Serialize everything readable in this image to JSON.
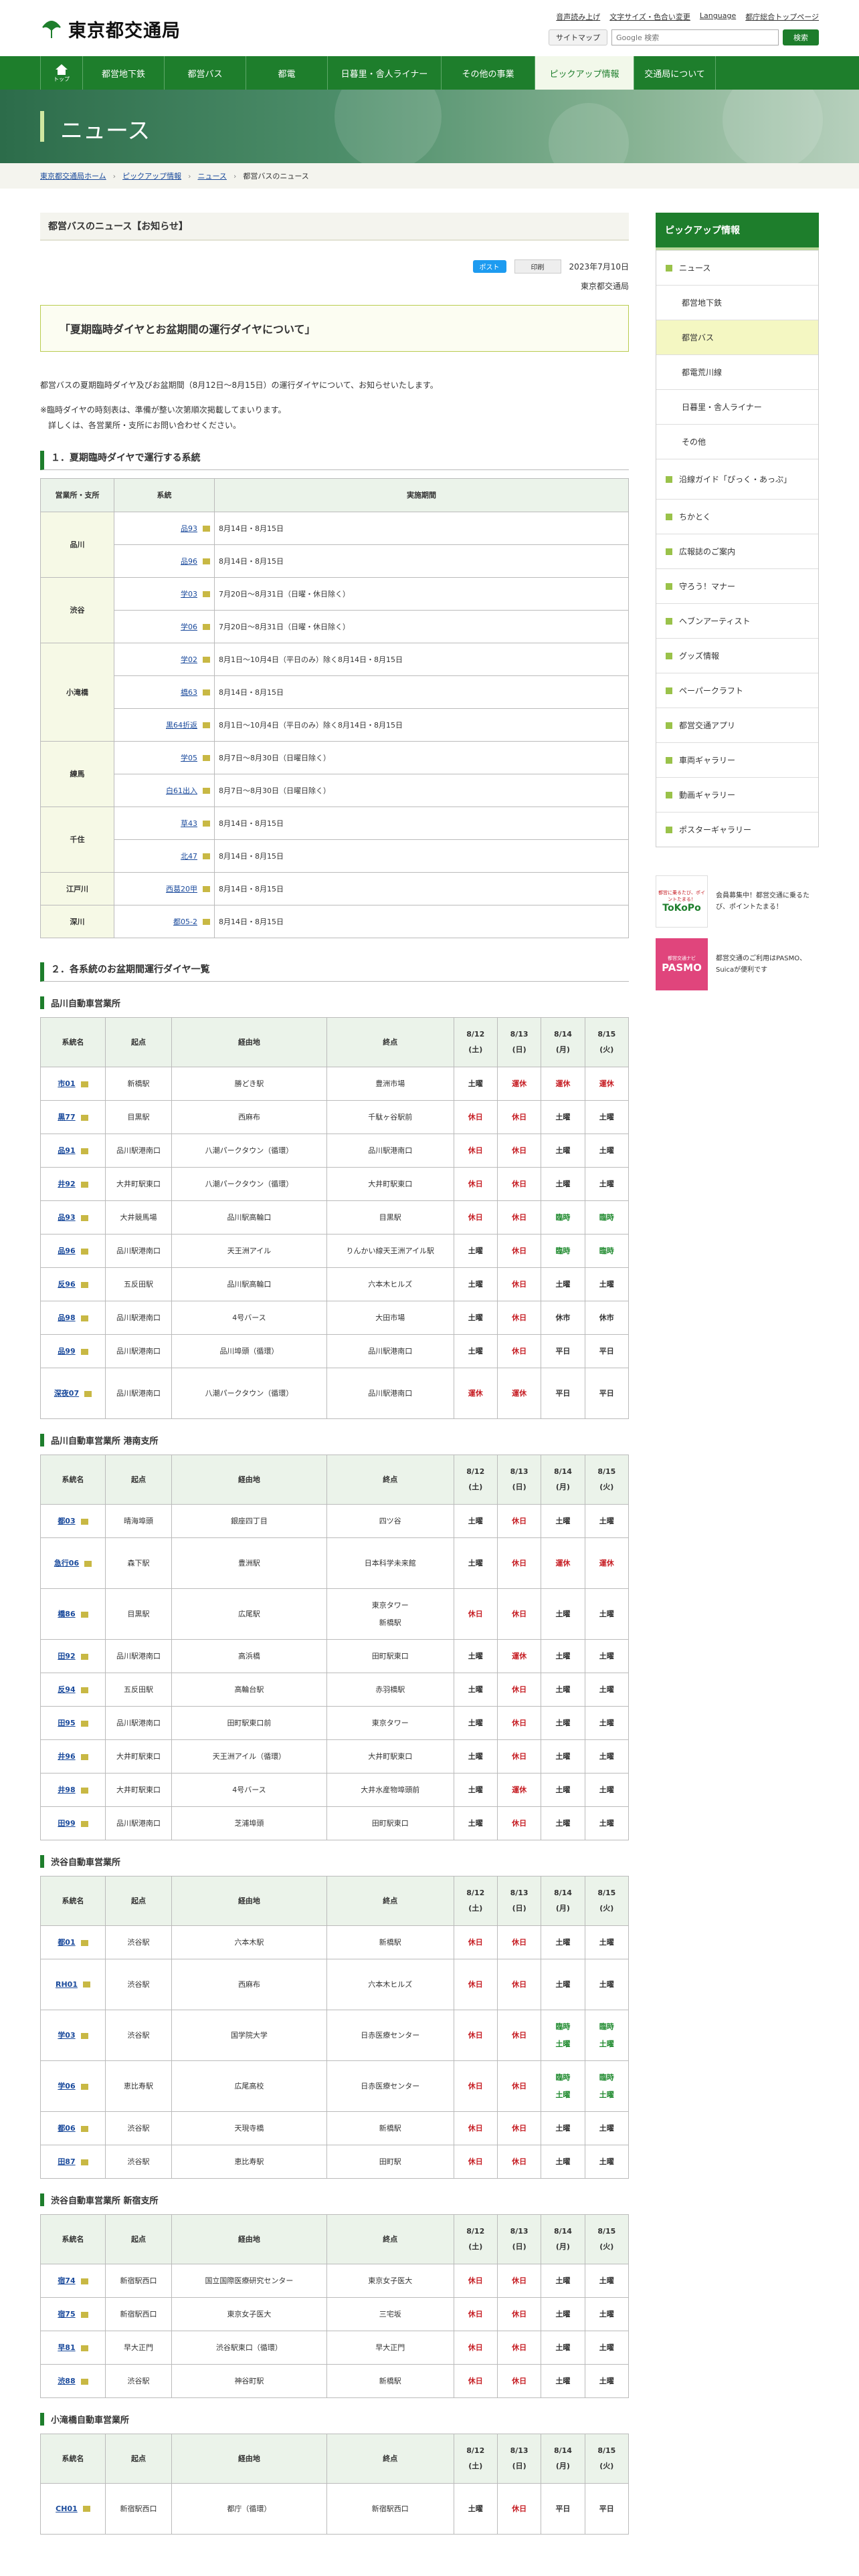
{
  "header": {
    "logo": "東京都交通局",
    "util": [
      "音声読み上げ",
      "文字サイズ・色合い変更",
      "Language",
      "都庁総合トップページ"
    ],
    "sitemap": "サイトマップ",
    "search_placeholder": "Google 検索",
    "search_button": "検索"
  },
  "gnav": {
    "home": "トップ",
    "items": [
      "都営地下鉄",
      "都営バス",
      "都電",
      "日暮里・舎人ライナー",
      "その他の事業",
      "ピックアップ情報",
      "交通局について"
    ]
  },
  "banner_title": "ニュース",
  "breadcrumb": [
    "東京都交通局ホーム",
    "ピックアップ情報",
    "ニュース",
    "都営バスのニュース"
  ],
  "page_title": "都営バスのニュース【お知らせ】",
  "share": {
    "tweet": "ポスト",
    "print": "印刷",
    "date": "2023年7月10日"
  },
  "org": "東京都交通局",
  "headline": "「夏期臨時ダイヤとお盆期間の運行ダイヤについて」",
  "lead": "都営バスの夏期臨時ダイヤ及びお盆期間（8月12日〜8月15日）の運行ダイヤについて、お知らせいたします。",
  "notes": [
    "※臨時ダイヤの時刻表は、準備が整い次第順次掲載してまいります。",
    "詳しくは、各営業所・支所にお問い合わせください。"
  ],
  "section1": "１．夏期臨時ダイヤで運行する系統",
  "t1": {
    "headers": [
      "営業所・支所",
      "系統",
      "実施期間"
    ],
    "groups": [
      {
        "branch": "品川",
        "rows": [
          [
            "品93",
            "8月14日・8月15日"
          ],
          [
            "品96",
            "8月14日・8月15日"
          ]
        ]
      },
      {
        "branch": "渋谷",
        "rows": [
          [
            "学03",
            "7月20日〜8月31日（日曜・休日除く）"
          ],
          [
            "学06",
            "7月20日〜8月31日（日曜・休日除く）"
          ]
        ]
      },
      {
        "branch": "小滝橋",
        "rows": [
          [
            "学02",
            "8月1日〜10月4日（平日のみ）除く8月14日・8月15日"
          ],
          [
            "橋63",
            "8月14日・8月15日"
          ],
          [
            "黒64折返",
            "8月1日〜10月4日（平日のみ）除く8月14日・8月15日"
          ]
        ]
      },
      {
        "branch": "練馬",
        "rows": [
          [
            "学05",
            "8月7日〜8月30日（日曜日除く）"
          ],
          [
            "白61出入",
            "8月7日〜8月30日（日曜日除く）"
          ]
        ]
      },
      {
        "branch": "千住",
        "rows": [
          [
            "草43",
            "8月14日・8月15日"
          ],
          [
            "北47",
            "8月14日・8月15日"
          ]
        ]
      },
      {
        "branch": "江戸川",
        "rows": [
          [
            "西葛20甲",
            "8月14日・8月15日"
          ]
        ]
      },
      {
        "branch": "深川",
        "rows": [
          [
            "都05-2",
            "8月14日・8月15日"
          ]
        ]
      }
    ]
  },
  "section2": "２．各系統のお盆期間運行ダイヤ一覧",
  "cols": [
    "系統名",
    "起点",
    "経由地",
    "終点"
  ],
  "days": [
    "8/12",
    "8/13",
    "8/14",
    "8/15"
  ],
  "dows": [
    "(土)",
    "(日)",
    "(月)",
    "(火)"
  ],
  "offices": [
    {
      "name": "品川自動車営業所",
      "rows": [
        [
          "市01",
          "新橋駅",
          "勝どき駅",
          "豊洲市場",
          "土曜",
          "運休",
          "運休",
          "運休"
        ],
        [
          "黒77",
          "目黒駅",
          "西麻布",
          "千駄ヶ谷駅前",
          "休日",
          "休日",
          "土曜",
          "土曜"
        ],
        [
          "品91",
          "品川駅港南口",
          "八潮パークタウン（循環）",
          "品川駅港南口",
          "休日",
          "休日",
          "土曜",
          "土曜"
        ],
        [
          "井92",
          "大井町駅東口",
          "八潮パークタウン（循環）",
          "大井町駅東口",
          "休日",
          "休日",
          "土曜",
          "土曜"
        ],
        [
          "品93",
          "大井競馬場",
          "品川駅高輪口",
          "目黒駅",
          "休日",
          "休日",
          "臨時",
          "臨時"
        ],
        [
          "品96",
          "品川駅港南口",
          "天王洲アイル",
          "りんかい線天王洲アイル駅",
          "土曜",
          "休日",
          "臨時",
          "臨時"
        ],
        [
          "反96",
          "五反田駅",
          "品川駅高輪口",
          "六本木ヒルズ",
          "土曜",
          "休日",
          "土曜",
          "土曜"
        ],
        [
          "品98",
          "品川駅港南口",
          "4号バース",
          "大田市場",
          "土曜",
          "休日",
          "休市",
          "休市"
        ],
        [
          "品99",
          "品川駅港南口",
          "品川埠頭（循環）",
          "品川駅港南口",
          "土曜",
          "休日",
          "平日",
          "平日"
        ],
        [
          "深夜07",
          "品川駅港南口",
          "八潮パークタウン（循環）",
          "品川駅港南口",
          "運休",
          "運休",
          "平日",
          "平日"
        ]
      ]
    },
    {
      "name": "品川自動車営業所 港南支所",
      "rows": [
        [
          "都03",
          "晴海埠頭",
          "銀座四丁目",
          "四ツ谷",
          "土曜",
          "休日",
          "土曜",
          "土曜"
        ],
        [
          "急行06",
          "森下駅",
          "豊洲駅",
          "日本科学未来館",
          "土曜",
          "休日",
          "運休",
          "運休"
        ],
        [
          "橋86",
          "目黒駅",
          "広尾駅",
          "東京タワー／新橋駅",
          "休日",
          "休日",
          "土曜",
          "土曜"
        ],
        [
          "田92",
          "品川駅港南口",
          "高浜橋",
          "田町駅東口",
          "土曜",
          "運休",
          "土曜",
          "土曜"
        ],
        [
          "反94",
          "五反田駅",
          "高輪台駅",
          "赤羽橋駅",
          "土曜",
          "休日",
          "土曜",
          "土曜"
        ],
        [
          "田95",
          "品川駅港南口",
          "田町駅東口前",
          "東京タワー",
          "土曜",
          "休日",
          "土曜",
          "土曜"
        ],
        [
          "井96",
          "大井町駅東口",
          "天王洲アイル（循環）",
          "大井町駅東口",
          "土曜",
          "休日",
          "土曜",
          "土曜"
        ],
        [
          "井98",
          "大井町駅東口",
          "4号バース",
          "大井水産物埠頭前",
          "土曜",
          "運休",
          "土曜",
          "土曜"
        ],
        [
          "田99",
          "品川駅港南口",
          "芝浦埠頭",
          "田町駅東口",
          "土曜",
          "休日",
          "土曜",
          "土曜"
        ]
      ]
    },
    {
      "name": "渋谷自動車営業所",
      "rows": [
        [
          "都01",
          "渋谷駅",
          "六本木駅",
          "新橋駅",
          "休日",
          "休日",
          "土曜",
          "土曜"
        ],
        [
          "RH01",
          "渋谷駅",
          "西麻布",
          "六本木ヒルズ",
          "休日",
          "休日",
          "土曜",
          "土曜"
        ],
        [
          "学03",
          "渋谷駅",
          "国学院大学",
          "日赤医療センター",
          "休日",
          "休日",
          "臨時／土曜",
          "臨時／土曜"
        ],
        [
          "学06",
          "恵比寿駅",
          "広尾高校",
          "日赤医療センター",
          "休日",
          "休日",
          "臨時／土曜",
          "臨時／土曜"
        ],
        [
          "都06",
          "渋谷駅",
          "天現寺橋",
          "新橋駅",
          "休日",
          "休日",
          "土曜",
          "土曜"
        ],
        [
          "田87",
          "渋谷駅",
          "恵比寿駅",
          "田町駅",
          "休日",
          "休日",
          "土曜",
          "土曜"
        ]
      ]
    },
    {
      "name": "渋谷自動車営業所 新宿支所",
      "rows": [
        [
          "宿74",
          "新宿駅西口",
          "国立国際医療研究センター",
          "東京女子医大",
          "休日",
          "休日",
          "土曜",
          "土曜"
        ],
        [
          "宿75",
          "新宿駅西口",
          "東京女子医大",
          "三宅坂",
          "休日",
          "休日",
          "土曜",
          "土曜"
        ],
        [
          "早81",
          "早大正門",
          "渋谷駅東口（循環）",
          "早大正門",
          "休日",
          "休日",
          "土曜",
          "土曜"
        ],
        [
          "渋88",
          "渋谷駅",
          "神谷町駅",
          "新橋駅",
          "休日",
          "休日",
          "土曜",
          "土曜"
        ]
      ]
    },
    {
      "name": "小滝橋自動車営業所",
      "rows": [
        [
          "CH01",
          "新宿駅西口",
          "都庁（循環）",
          "新宿駅西口",
          "土曜",
          "休日",
          "平日",
          "平日"
        ]
      ]
    }
  ],
  "sidebar": {
    "title": "ピックアップ情報",
    "items": [
      {
        "label": "ニュース",
        "level": 1
      },
      {
        "label": "都営地下鉄",
        "level": 2
      },
      {
        "label": "都営バス",
        "level": 2,
        "on": true
      },
      {
        "label": "都電荒川線",
        "level": 2
      },
      {
        "label": "日暮里・舎人ライナー",
        "level": 2
      },
      {
        "label": "その他",
        "level": 2
      },
      {
        "label": "沿線ガイド「ぴっく・あっぷ」",
        "level": 1
      },
      {
        "label": "ちかとく",
        "level": 1
      },
      {
        "label": "広報誌のご案内",
        "level": 1
      },
      {
        "label": "守ろう！マナー",
        "level": 1
      },
      {
        "label": "ヘブンアーティスト",
        "level": 1
      },
      {
        "label": "グッズ情報",
        "level": 1
      },
      {
        "label": "ペーパークラフト",
        "level": 1
      },
      {
        "label": "都営交通アプリ",
        "level": 1
      },
      {
        "label": "車両ギャラリー",
        "level": 1
      },
      {
        "label": "動画ギャラリー",
        "level": 1
      },
      {
        "label": "ポスターギャラリー",
        "level": 1
      }
    ]
  },
  "ads": [
    {
      "img": "ToKoPo",
      "small": "都営に乗るたび、ポイントたまる！",
      "text": "会員募集中！都営交通に乗るたび、ポイントたまる！"
    },
    {
      "img": "PASMO",
      "small": "都営交通ナビ",
      "text": "都営交通のご利用はPASMO、Suicaが便利です"
    }
  ],
  "colors": {
    "green": "#1e7e2c",
    "red": "#c61d23",
    "accent_green": "#1f8a2e"
  }
}
